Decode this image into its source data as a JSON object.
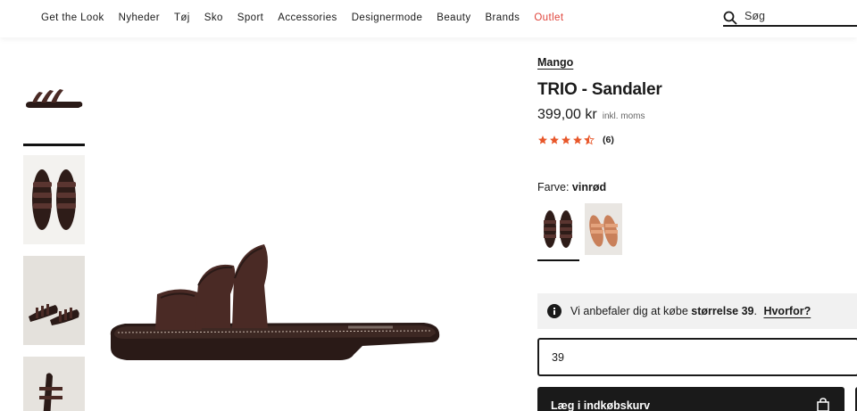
{
  "nav": {
    "items": [
      "Get the Look",
      "Nyheder",
      "Tøj",
      "Sko",
      "Sport",
      "Accessories",
      "Designermode",
      "Beauty",
      "Brands",
      "Outlet"
    ],
    "search_placeholder": "Søg"
  },
  "product": {
    "brand": "Mango",
    "title": "TRIO - Sandaler",
    "price": "399,00 kr",
    "vat_note": "inkl. moms",
    "rating": {
      "stars": 4.5,
      "count": "(6)"
    },
    "color_label": "Farve:",
    "color_value": "vinrød",
    "swatches": [
      {
        "name": "vinrød",
        "color": "#3a2521",
        "selected": true
      },
      {
        "name": "cognac",
        "color": "#d4916a",
        "selected": false
      }
    ]
  },
  "size_advice": {
    "prefix": "Vi anbefaler dig at købe",
    "size": "størrelse 39",
    "suffix": ".",
    "link": "Hvorfor?"
  },
  "size_select": {
    "value": "39"
  },
  "cart": {
    "label": "Læg i indkøbskurv"
  },
  "colors": {
    "accent_outlet": "#e0453c",
    "star": "#e8572a",
    "text": "#1a1a1a",
    "strap": "#4a2a25"
  }
}
